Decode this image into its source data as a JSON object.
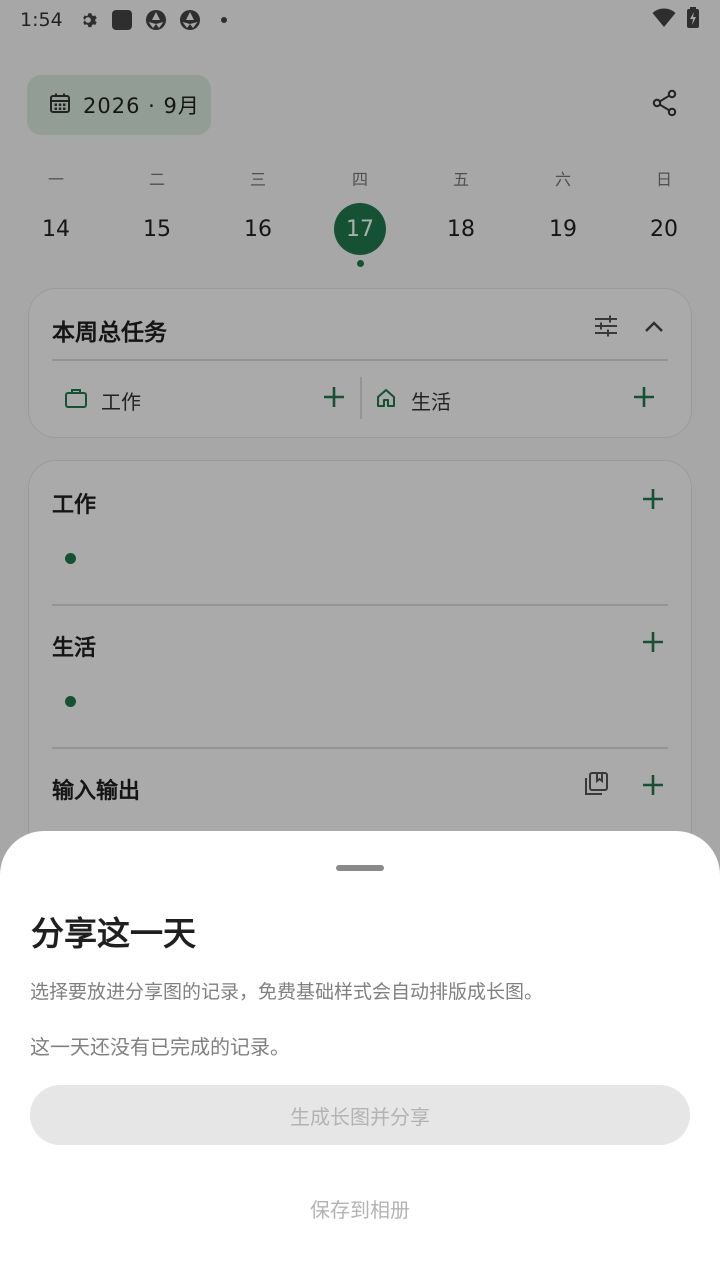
{
  "status_bar": {
    "time": "1:54",
    "icons": [
      "gear-icon",
      "square-app-icon",
      "aperture-icon",
      "aperture-icon",
      "dot-icon",
      "wifi-icon",
      "battery-charging-icon"
    ]
  },
  "header": {
    "date_label": "2026 · 9月",
    "date_icon": "calendar-icon",
    "share_icon": "share-icon"
  },
  "week": {
    "weekday_labels": [
      "一",
      "二",
      "三",
      "四",
      "五",
      "六",
      "日"
    ],
    "days": [
      "14",
      "15",
      "16",
      "17",
      "18",
      "19",
      "20"
    ],
    "selected_day": "17"
  },
  "weekly_tasks": {
    "title": "本周总任务",
    "filter_icon": "sliders-icon",
    "collapse_icon": "chevron-up-icon",
    "categories": [
      {
        "label": "工作",
        "icon": "briefcase-icon"
      },
      {
        "label": "生活",
        "icon": "home-icon"
      }
    ]
  },
  "sections": [
    {
      "title": "工作"
    },
    {
      "title": "生活"
    },
    {
      "title": "输入输出",
      "extra_icon": "library-icon"
    }
  ],
  "share_sheet": {
    "title": "分享这一天",
    "description": "选择要放进分享图的记录，免费基础样式会自动排版成长图。",
    "empty_message": "这一天还没有已完成的记录。",
    "generate_button": "生成长图并分享",
    "save_button": "保存到相册"
  },
  "colors": {
    "accent": "#1f7a4d",
    "chip_bg": "#d8e8dc",
    "disabled_text": "#b3b3b3"
  }
}
